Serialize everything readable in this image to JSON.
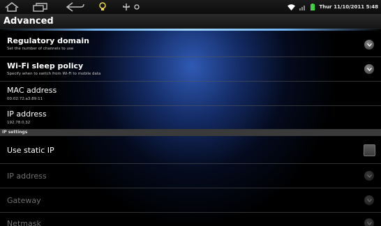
{
  "status_bar": {
    "datetime": "Thur 11/10/2011 5:48",
    "icons": [
      "home-icon",
      "recent-apps-icon",
      "back-icon",
      "bulb-icon",
      "usb-icon",
      "notification-icon",
      "wifi-icon",
      "signal-icon",
      "battery-icon"
    ]
  },
  "header": {
    "title": "Advanced"
  },
  "settings": [
    {
      "title": "Regulatory domain",
      "subtitle": "Set the number of channels to use",
      "control": "chevron"
    },
    {
      "title": "Wi-Fi sleep policy",
      "subtitle": "Specify when to switch from Wi-Fi to mobile data",
      "control": "chevron"
    },
    {
      "title": "MAC address",
      "subtitle": "00:02:72:a3:89:11"
    },
    {
      "title": "IP address",
      "subtitle": "192.78.0.32"
    }
  ],
  "ip_settings": {
    "section_label": "IP settings",
    "use_static_ip": {
      "label": "Use static IP",
      "checked": false
    },
    "fields": [
      {
        "label": "IP address",
        "enabled": false
      },
      {
        "label": "Gateway",
        "enabled": false
      },
      {
        "label": "Netmask",
        "enabled": false
      }
    ]
  },
  "colors": {
    "accent_glow": "#7fbfff",
    "disabled_text": "#6f6f6f"
  }
}
